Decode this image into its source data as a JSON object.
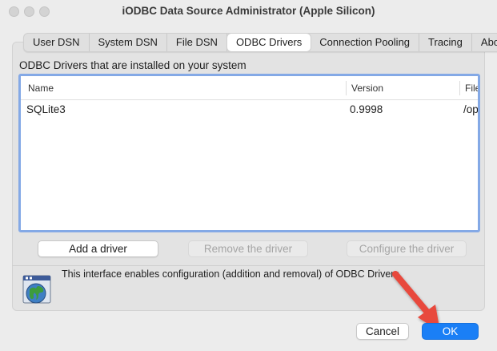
{
  "window": {
    "title": "iODBC Data Source Administrator (Apple Silicon)"
  },
  "tabs": [
    {
      "label": "User DSN",
      "active": false
    },
    {
      "label": "System DSN",
      "active": false
    },
    {
      "label": "File DSN",
      "active": false
    },
    {
      "label": "ODBC Drivers",
      "active": true
    },
    {
      "label": "Connection Pooling",
      "active": false
    },
    {
      "label": "Tracing",
      "active": false
    },
    {
      "label": "About",
      "active": false
    }
  ],
  "drivers": {
    "section_label": "ODBC Drivers that are installed on your system",
    "columns": [
      "Name",
      "Version",
      "File"
    ],
    "rows": [
      {
        "name": "SQLite3",
        "version": "0.9998",
        "file": "/op"
      }
    ],
    "buttons": {
      "add": "Add a driver",
      "remove": "Remove the driver",
      "configure": "Configure the driver"
    }
  },
  "info": {
    "text": "This interface enables configuration (addition and removal) of ODBC Drivers.",
    "icon": "globe-window-icon"
  },
  "footer": {
    "cancel_label": "Cancel",
    "ok_label": "OK"
  },
  "colors": {
    "accent": "#1a7ff6",
    "selection_border": "#84a9e6",
    "annotation_arrow": "#e8483c"
  }
}
